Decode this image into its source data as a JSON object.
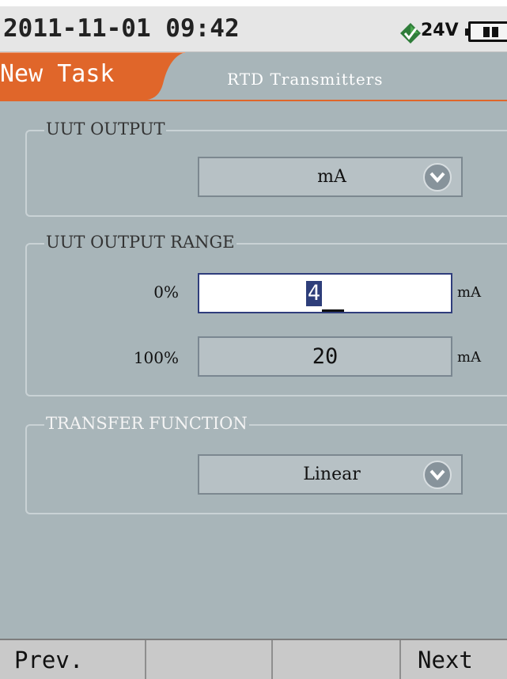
{
  "status_bar": {
    "datetime": "2011-11-01 09:42",
    "voltage": "24V",
    "power_icon": "power-diamond-icon",
    "battery_icon": "battery-icon"
  },
  "header": {
    "task_tab": "New Task",
    "title": "RTD Transmitters",
    "accent_color": "#e0662a"
  },
  "uut_output": {
    "legend": "UUT OUTPUT",
    "selected": "mA"
  },
  "uut_output_range": {
    "legend": "UUT OUTPUT RANGE",
    "rows": [
      {
        "label": "0%",
        "value": "4",
        "unit": "mA",
        "active": true
      },
      {
        "label": "100%",
        "value": "20",
        "unit": "mA",
        "active": false
      }
    ]
  },
  "transfer_function": {
    "legend": "TRANSFER FUNCTION",
    "selected": "Linear"
  },
  "softkeys": {
    "prev": "Prev.",
    "key2": "",
    "key3": "",
    "next": "Next"
  }
}
